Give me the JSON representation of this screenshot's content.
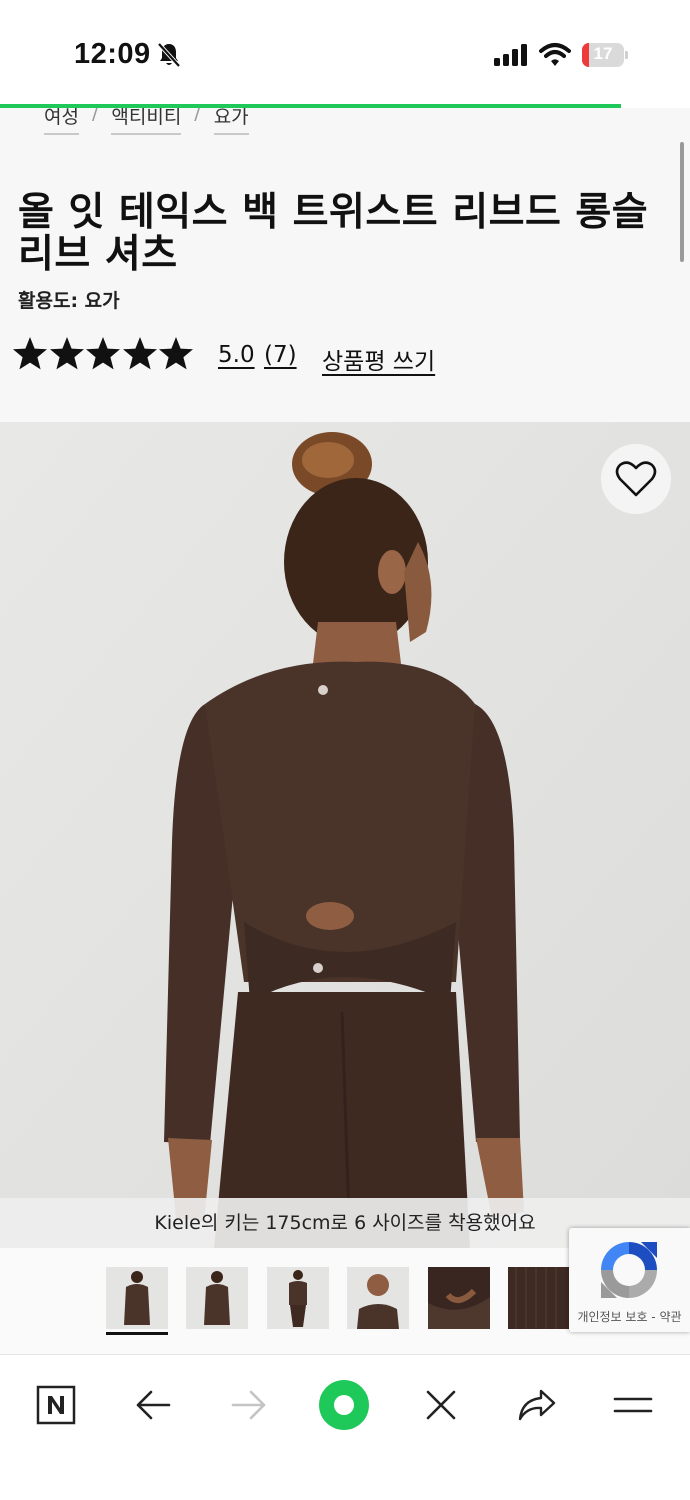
{
  "status_bar": {
    "time": "12:09",
    "battery_level": "17",
    "battery_fraction": 0.17
  },
  "page_load_progress": 0.9,
  "breadcrumb": [
    "여성",
    "액티비티",
    "요가"
  ],
  "product": {
    "title": "올 잇 테익스 백 트위스트 리브드 롱슬리브 셔츠",
    "activity_label": "활용도: 요가",
    "rating_stars": 5,
    "rating_value": "5.0",
    "review_count": "(7)",
    "write_review_label": "상품평 쓰기"
  },
  "image": {
    "caption": "Kiele의 키는 175cm로 6 사이즈를 착용했어요",
    "thumbnail_count": 6,
    "selected_thumbnail": 1
  },
  "recaptcha": {
    "label": "개인정보 보호 - 약관"
  },
  "colors": {
    "accent_green": "#1ec95a",
    "garment_brown": "#4a3329",
    "battery_red": "#ee3a3a"
  },
  "icons": {
    "bell": "bell-slash-icon",
    "heart": "heart-outline-icon",
    "home": "naver-n-icon",
    "back": "arrow-left-icon",
    "forward": "arrow-right-icon",
    "green": "green-dot-icon",
    "close": "close-icon",
    "share": "share-icon",
    "menu": "menu-icon"
  }
}
